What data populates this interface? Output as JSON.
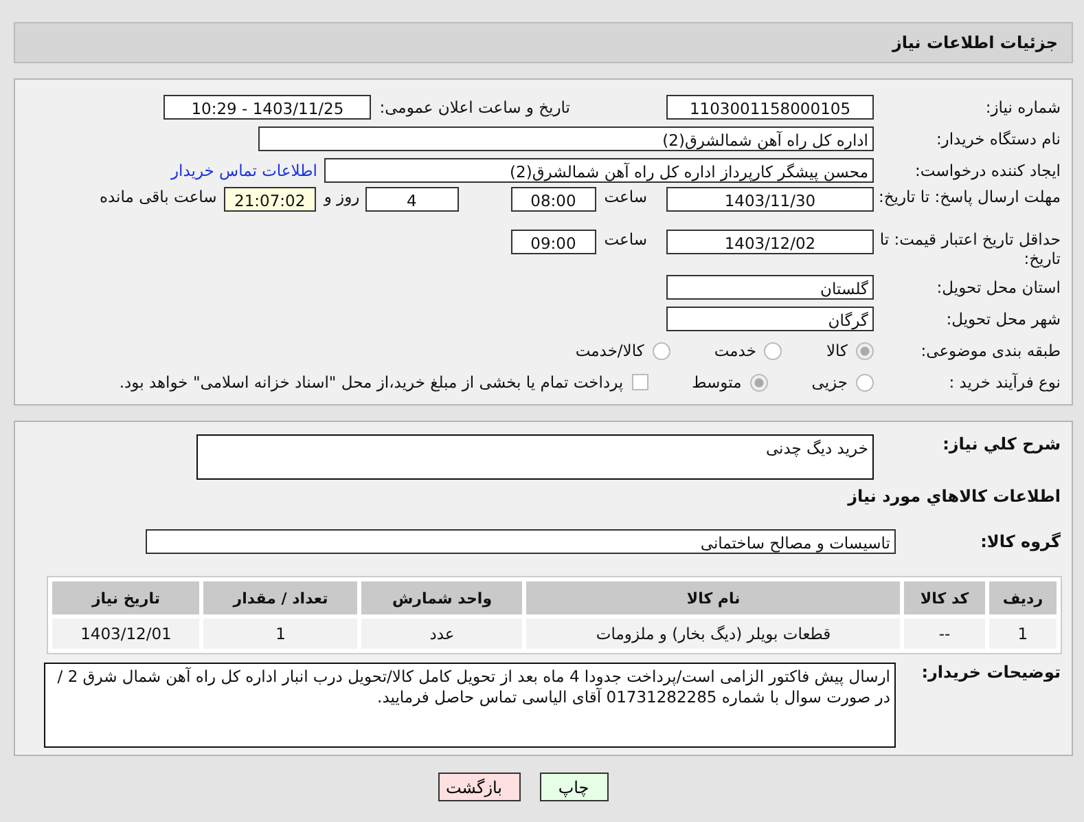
{
  "title": "جزئیات اطلاعات نیاز",
  "need_number": {
    "label": "شماره نیاز:",
    "value": "1103001158000105"
  },
  "announce": {
    "label": "تاریخ و ساعت اعلان عمومی:",
    "value": "1403/11/25 - 10:29"
  },
  "buyer": {
    "label": "نام دستگاه خریدار:",
    "value": "اداره کل راه آهن شمالشرق(2)"
  },
  "requester": {
    "label": "ایجاد کننده درخواست:",
    "value": "محسن پیشگر کارپرداز اداره کل راه آهن شمالشرق(2)",
    "link": "اطلاعات تماس خریدار"
  },
  "deadline": {
    "label": "مهلت ارسال پاسخ: تا تاریخ:",
    "date": "1403/11/30",
    "time_label": "ساعت",
    "time": "08:00",
    "days": "4",
    "days_label": "روز و",
    "remaining": "21:07:02",
    "remaining_label": "ساعت باقی مانده"
  },
  "validity": {
    "label": "حداقل تاریخ اعتبار قیمت: تا تاریخ:",
    "date": "1403/12/02",
    "time_label": "ساعت",
    "time": "09:00"
  },
  "province": {
    "label": "استان محل تحویل:",
    "value": "گلستان"
  },
  "city": {
    "label": "شهر محل تحویل:",
    "value": "گرگان"
  },
  "category": {
    "label": "طبقه بندی موضوعی:",
    "options": [
      {
        "label": "کالا",
        "selected": true
      },
      {
        "label": "خدمت",
        "selected": false
      },
      {
        "label": "کالا/خدمت",
        "selected": false
      }
    ]
  },
  "process": {
    "label": "نوع فرآیند خرید :",
    "options": [
      {
        "label": "جزیی",
        "selected": false
      },
      {
        "label": "متوسط",
        "selected": true
      }
    ],
    "treasury": {
      "checked": false,
      "label": "پرداخت تمام یا بخشی از مبلغ خرید،از محل \"اسناد خزانه اسلامی\" خواهد بود."
    }
  },
  "summary": {
    "label": "شرح کلي نياز:",
    "value": "خرید دیگ چدنی"
  },
  "goods_heading": "اطلاعات کالاهاي مورد نياز",
  "goods_group": {
    "label": "گروه کالا:",
    "value": "تاسیسات و مصالح ساختمانی"
  },
  "table": {
    "columns": [
      "ردیف",
      "کد کالا",
      "نام کالا",
      "واحد شمارش",
      "تعداد / مقدار",
      "تاریخ نیاز"
    ],
    "rows": [
      [
        "1",
        "--",
        "قطعات بویلر (دیگ بخار) و ملزومات",
        "عدد",
        "1",
        "1403/12/01"
      ]
    ]
  },
  "buyer_notes": {
    "label": "توضیحات خریدار:",
    "value": "ارسال پیش فاکتور الزامی است/پرداخت جدودا 4 ماه بعد از تحویل کامل کالا/تحویل درب انبار اداره کل راه آهن شمال شرق 2 / در صورت سوال با شماره 01731282285 آقای الیاسی تماس حاصل فرمایید."
  },
  "buttons": [
    {
      "label": "چاپ",
      "kind": "print"
    },
    {
      "label": "بازگشت",
      "kind": "back"
    }
  ]
}
